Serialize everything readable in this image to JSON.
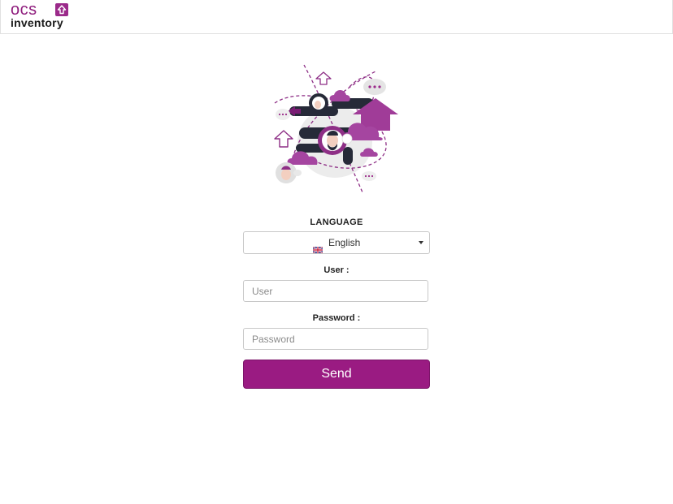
{
  "header": {
    "logo_top": "OCS",
    "logo_bottom": "inventory"
  },
  "colors": {
    "brand": "#9a1b82",
    "brand_dark": "#2a2d3a"
  },
  "form": {
    "language_label": "LANGUAGE",
    "language_selected": "English",
    "language_flag_icon": "uk-flag-icon",
    "user_label": "User :",
    "user_placeholder": "User",
    "password_label": "Password :",
    "password_placeholder": "Password",
    "send_label": "Send"
  }
}
